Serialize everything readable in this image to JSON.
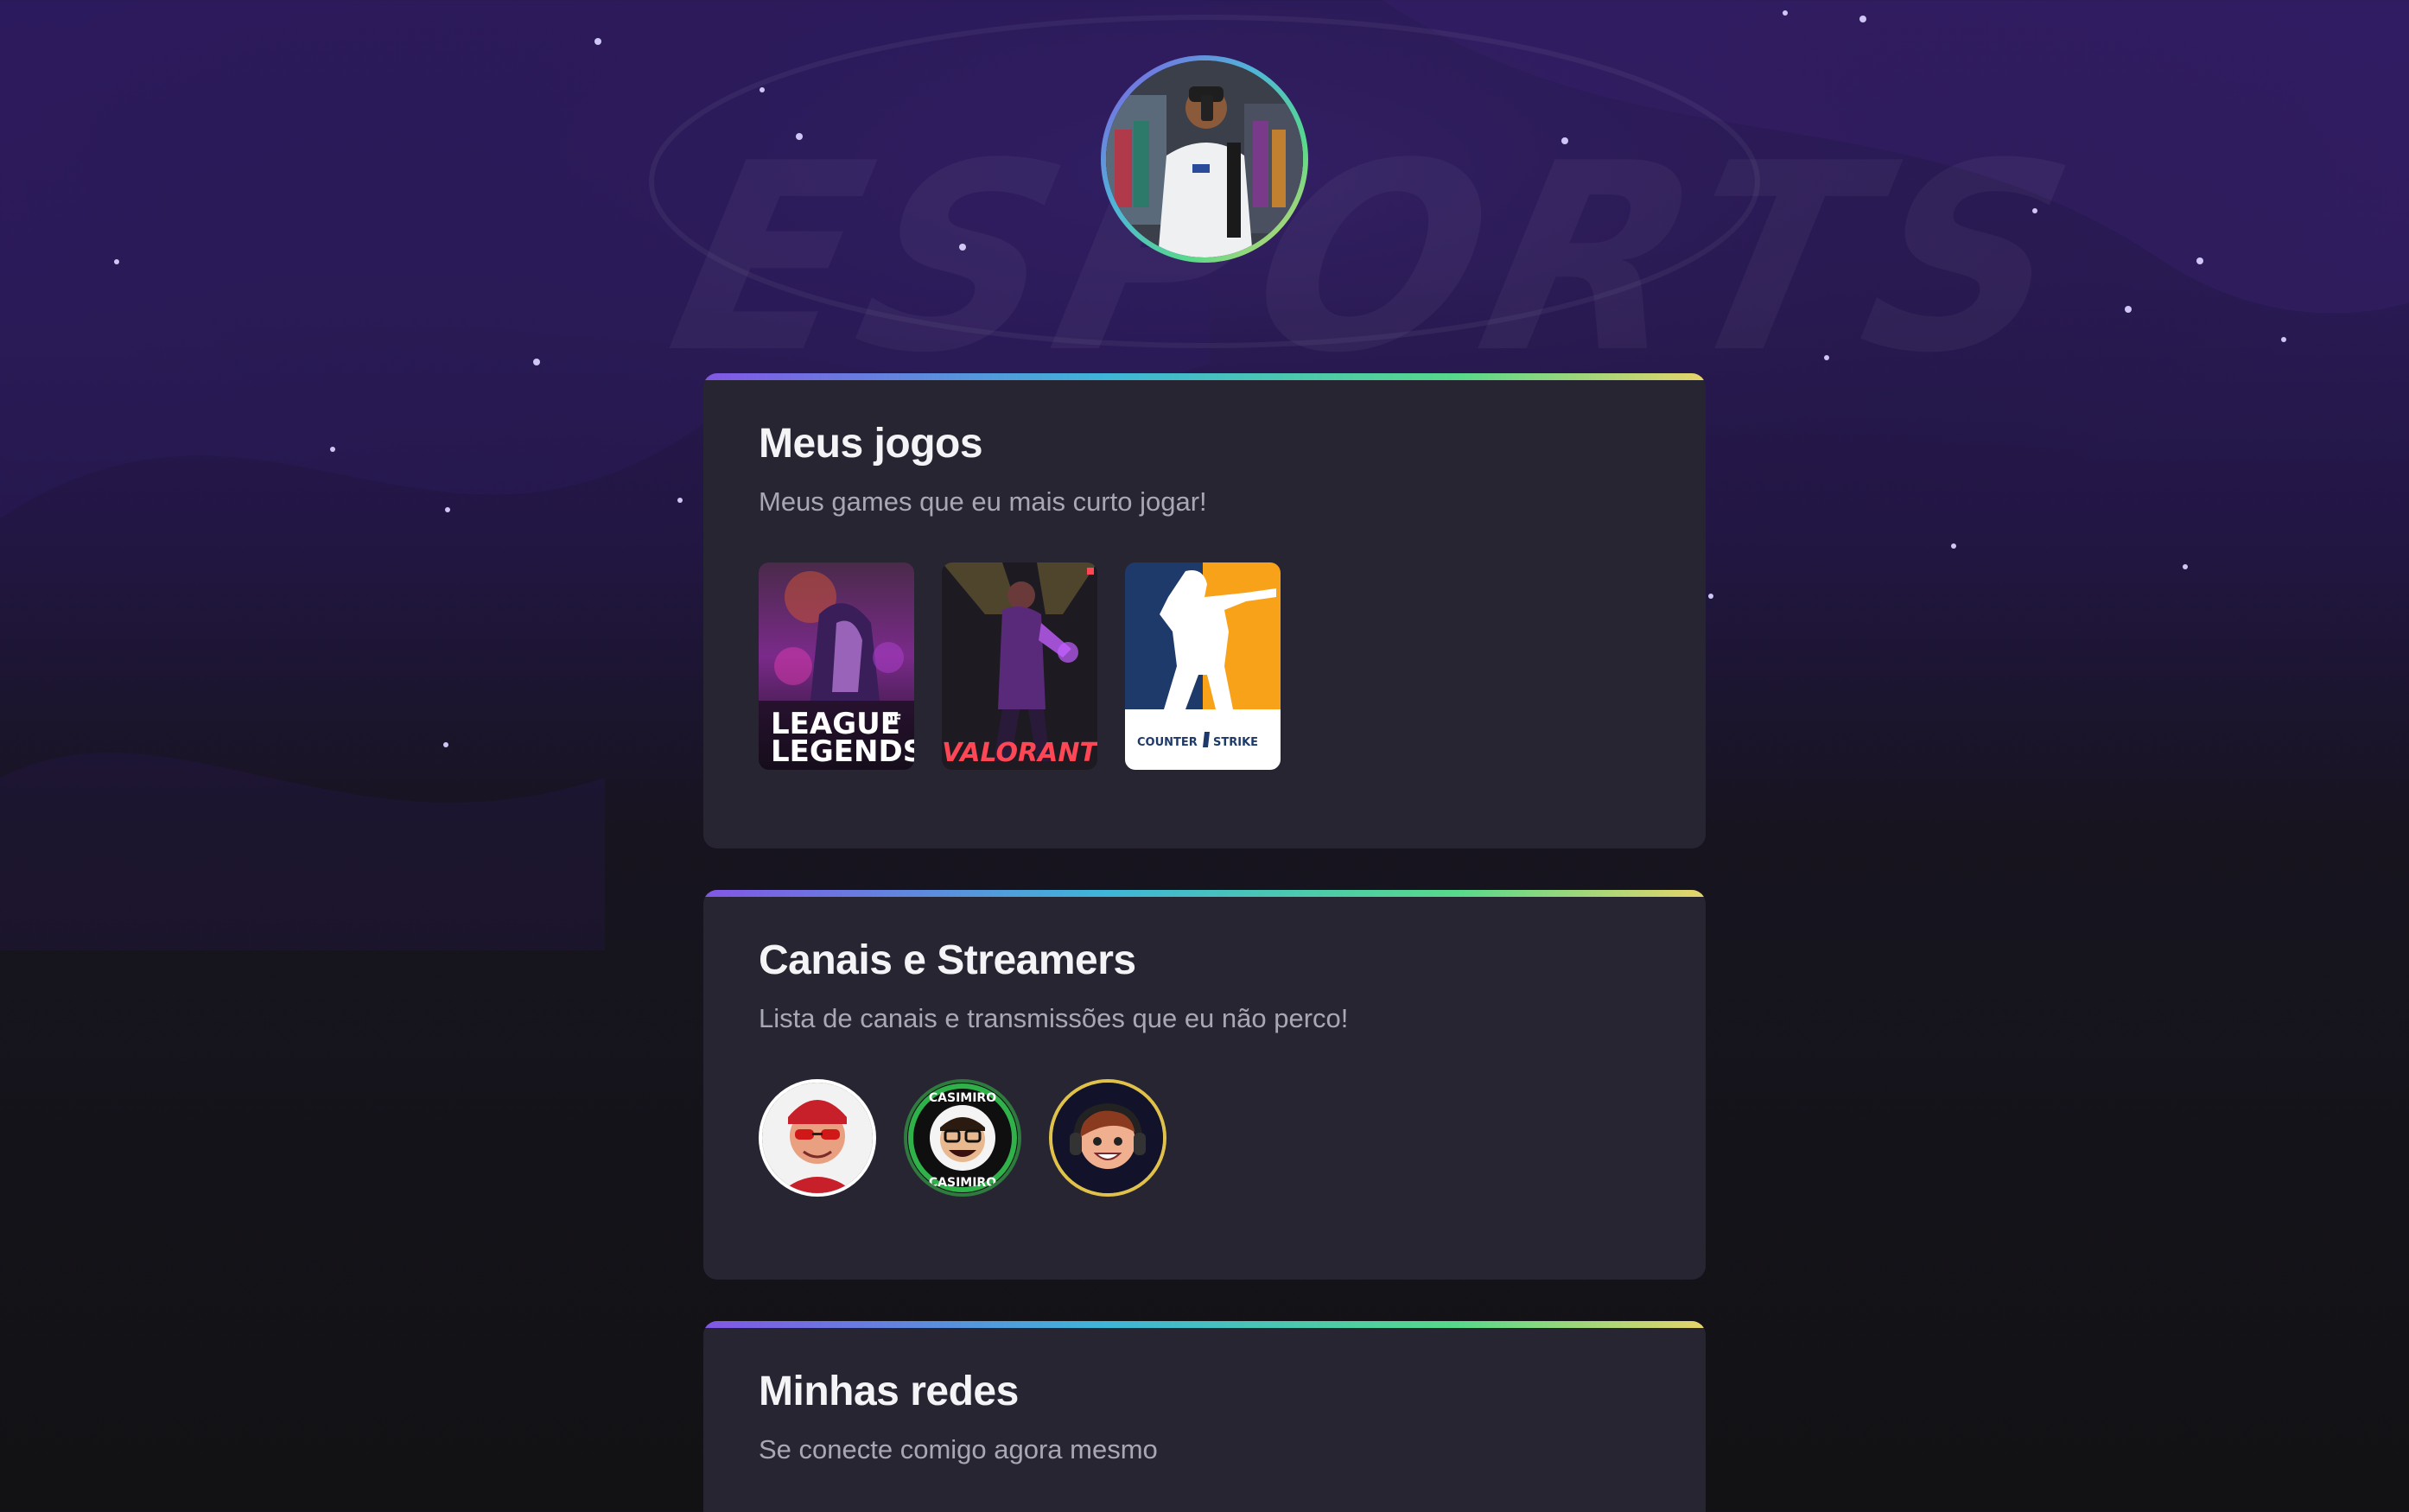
{
  "background": {
    "watermark": "ESPORTS"
  },
  "profile": {
    "avatar_alt": "profile photo",
    "ring_colors": [
      "#8257e5",
      "#4fb6d8",
      "#56d98b",
      "#e7d46a"
    ]
  },
  "cards": {
    "games": {
      "title": "Meus jogos",
      "subtitle": "Meus games que eu mais curto jogar!",
      "items": [
        {
          "name": "League of Legends",
          "logo_line1": "LEAGUE",
          "logo_small": "OF",
          "logo_line2": "LEGENDS"
        },
        {
          "name": "Valorant",
          "logo": "VALORANT"
        },
        {
          "name": "Counter-Strike",
          "logo_left": "COUNTER",
          "logo_right": "STRIKE"
        }
      ]
    },
    "channels": {
      "title": "Canais e Streamers",
      "subtitle": "Lista de canais e transmissões que eu não perco!",
      "items": [
        {
          "name": "streamer-red"
        },
        {
          "name": "casimiro",
          "badge_top": "CASIMIRO",
          "badge_bottom": "CASIMIRO"
        },
        {
          "name": "streamer-headset"
        }
      ]
    },
    "social": {
      "title": "Minhas redes",
      "subtitle": "Se conecte comigo agora mesmo"
    }
  },
  "colors": {
    "accent_purple": "#8257e5",
    "card_bg": "#282533",
    "text_primary": "#f4f4f6",
    "text_secondary": "#a8a8b3"
  }
}
